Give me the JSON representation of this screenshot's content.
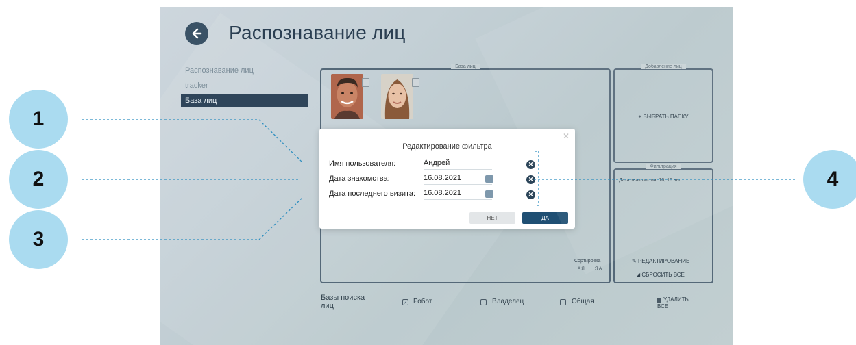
{
  "app": {
    "title": "Распознавание лиц"
  },
  "sidebar": {
    "items": [
      {
        "label": "Распознавание лиц"
      },
      {
        "label": "tracker"
      },
      {
        "label": "База лиц"
      }
    ]
  },
  "face_db": {
    "title": "База лиц"
  },
  "add_faces": {
    "title": "Добавление лиц",
    "choose_folder": "+ ВЫБРАТЬ ПАПКУ"
  },
  "filter_panel": {
    "title": "Фильтрация",
    "summary": "Дата знакомства: 16, 16 авг.",
    "edit_label": "РЕДАКТИРОВАНИЕ",
    "reset_label": "СБРОСИТЬ ВСЕ"
  },
  "sort": {
    "label": "Сортировка",
    "asc": "A Я",
    "desc": "Я A"
  },
  "search_bases": {
    "label": "Базы поиска лиц",
    "options": [
      {
        "label": "Робот",
        "checked": true
      },
      {
        "label": "Владелец",
        "checked": false
      },
      {
        "label": "Общая",
        "checked": false
      }
    ],
    "delete_all": "УДАЛИТЬ ВСЕ"
  },
  "dialog": {
    "title": "Редактирование фильтра",
    "fields": [
      {
        "label": "Имя пользователя:",
        "value": "Андрей"
      },
      {
        "label": "Дата знакомства:",
        "value": "16.08.2021"
      },
      {
        "label": "Дата последнего визита:",
        "value": "16.08.2021"
      }
    ],
    "no_label": "НЕТ",
    "yes_label": "ДА"
  },
  "callouts": [
    {
      "number": "1"
    },
    {
      "number": "2"
    },
    {
      "number": "3"
    },
    {
      "number": "4"
    }
  ],
  "colors": {
    "callout": "#aadbf0",
    "accent": "#1f4f73",
    "dark": "#2f455a",
    "dashed": "#2f8fc0"
  },
  "icons": [
    "arrow-left-icon",
    "trash-icon",
    "calendar-icon",
    "clear-x-icon",
    "close-icon",
    "pencil-icon",
    "eraser-icon",
    "sort-icon",
    "checkbox-icon"
  ]
}
